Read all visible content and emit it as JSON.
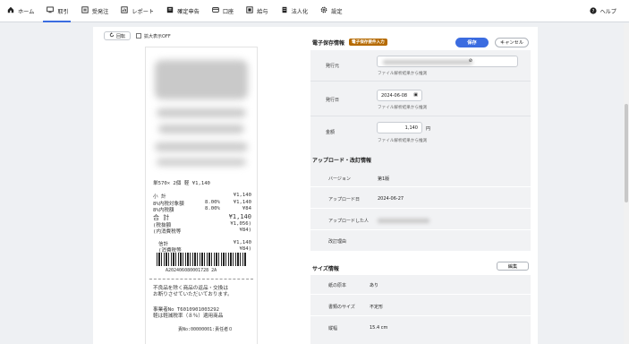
{
  "nav": {
    "items": [
      {
        "label": "ホーム",
        "icon": "home-icon"
      },
      {
        "label": "取引",
        "icon": "monitor-icon",
        "active": true
      },
      {
        "label": "受発注",
        "icon": "order-icon"
      },
      {
        "label": "レポート",
        "icon": "report-icon"
      },
      {
        "label": "確定申告",
        "icon": "tax-return-icon"
      },
      {
        "label": "口座",
        "icon": "credit-card-icon"
      },
      {
        "label": "給与",
        "icon": "payroll-icon"
      },
      {
        "label": "法人化",
        "icon": "building-icon"
      },
      {
        "label": "設定",
        "icon": "gear-icon"
      }
    ],
    "help": "ヘルプ"
  },
  "preview": {
    "rotate": "回転",
    "zoom": "拡大表示OFF",
    "receipt": {
      "item_line": "単570× 2個  軽 ¥1,140",
      "subtotal_label": "小  計",
      "subtotal": "¥1,140",
      "target_label": "8%内税対象額",
      "target_count": "8.00%",
      "target_value": "¥1,140",
      "tax_label": "8%内税額",
      "tax_count": "8.00%",
      "tax_value": "¥84",
      "total_label": "合 計",
      "total": "¥1,140",
      "excl_label": "(税抜額",
      "excl": "¥1,056)",
      "incl_label": "(内消費税等",
      "incl": "¥84)",
      "credit_label": "信計",
      "credit": "¥1,140",
      "credit_tax_label": "(消費税等",
      "credit_tax": "¥84)",
      "barcode_text": "A202406080001728 2A",
      "note1": "不良品を除く商品の返品・交換は",
      "note2": "お断りさせていただいております。",
      "reg_no": "事業者No T6010901003292",
      "reduced": "軽は軽減税率（８％）適用商品",
      "staff": "責No:00000001:責任者０"
    }
  },
  "edoc": {
    "title": "電子保存情報",
    "badge": "電子保存要件入力",
    "save": "保存",
    "cancel": "キャンセル",
    "issuer_label": "発行元",
    "issuer_hint": "ファイル解析結果から推測",
    "date_label": "発行日",
    "date_value": "2024-06-08",
    "date_hint": "ファイル解析結果から推測",
    "amount_label": "金額",
    "amount_value": "1,140",
    "amount_unit": "円",
    "amount_hint": "ファイル解析結果から推測"
  },
  "upload": {
    "title": "アップロード・改訂情報",
    "version_label": "バージョン",
    "version_value": "第1版",
    "date_label": "アップロード日",
    "date_value": "2024-06-27",
    "user_label": "アップロードした人",
    "reason_label": "改訂理由"
  },
  "size": {
    "title": "サイズ情報",
    "edit": "編集",
    "paper_label": "紙の原本",
    "paper_value": "あり",
    "docsize_label": "書類のサイズ",
    "docsize_value": "不定形",
    "height_label": "縦幅",
    "height_value": "15.4 cm"
  }
}
